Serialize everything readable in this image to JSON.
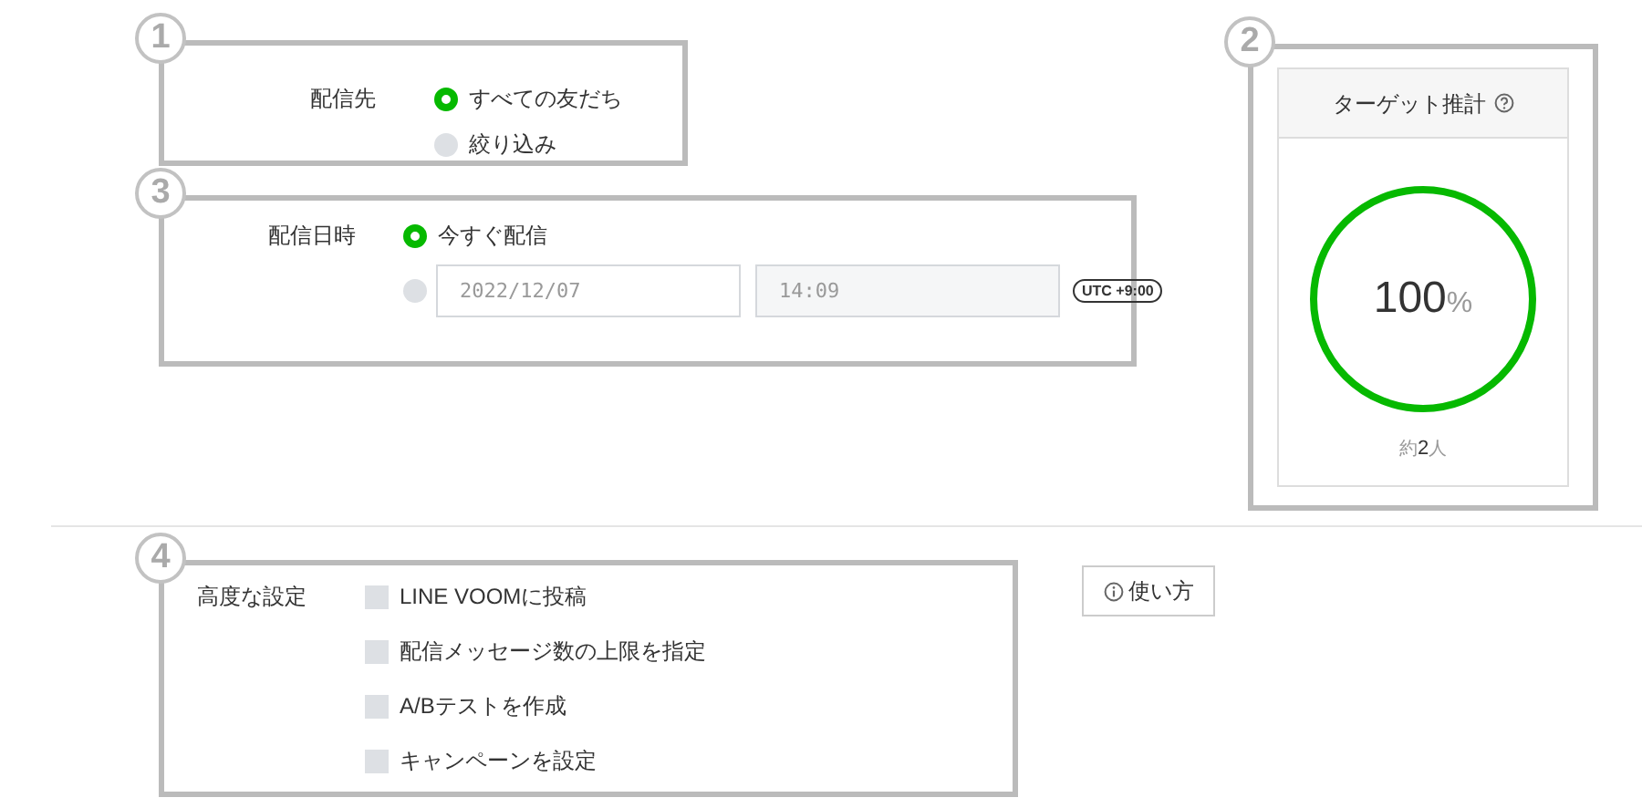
{
  "delivery_target": {
    "annotation": "1",
    "label": "配信先",
    "options": [
      {
        "label": "すべての友だち",
        "selected": true
      },
      {
        "label": "絞り込み",
        "selected": false
      }
    ]
  },
  "target_estimate": {
    "annotation": "2",
    "title": "ターゲット推計",
    "value": "100",
    "unit": "%",
    "level": 1,
    "count": "約**2**人"
  },
  "delivery_datetime": {
    "annotation": "3",
    "label": "配信日時",
    "options": [
      {
        "kind": "now",
        "label": "今すぐ配信",
        "selected": true
      },
      {
        "kind": "schedule",
        "selected": false,
        "date": "2022/12/07",
        "time": "14:09",
        "timezone": "UTC +9:00"
      }
    ]
  },
  "advanced_settings": {
    "annotation": "4",
    "label": "高度な設定",
    "options": [
      {
        "label": "LINE VOOMに投稿",
        "checked": false
      },
      {
        "label": "配信メッセージ数の上限を指定",
        "checked": false
      },
      {
        "label": "A/Bテストを作成",
        "checked": false
      },
      {
        "label": "キャンペーンを設定",
        "checked": false
      }
    ]
  },
  "help_button": {
    "label": "使い方"
  }
}
